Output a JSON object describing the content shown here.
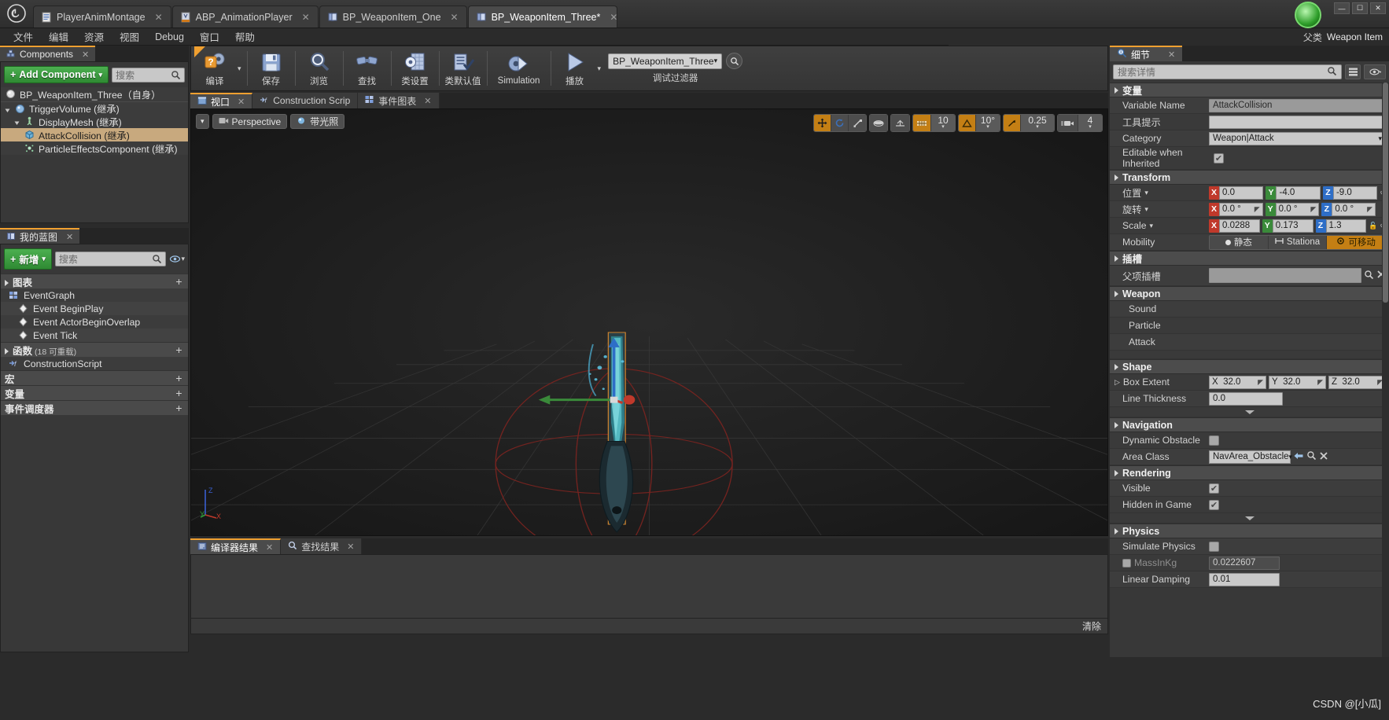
{
  "window": {
    "app_icon": "unreal-logo",
    "minimize": "—",
    "maximize": "☐",
    "close": "✕"
  },
  "tabs": [
    {
      "label": "PlayerAnimMontage",
      "icon": "anim-montage-icon",
      "active": false,
      "close": "✕"
    },
    {
      "label": "ABP_AnimationPlayer",
      "icon": "anim-blueprint-icon",
      "active": false,
      "close": "✕"
    },
    {
      "label": "BP_WeaponItem_One",
      "icon": "blueprint-icon",
      "active": false,
      "close": "✕"
    },
    {
      "label": "BP_WeaponItem_Three*",
      "icon": "blueprint-icon",
      "active": true,
      "close": "✕"
    }
  ],
  "menu": [
    "文件",
    "编辑",
    "资源",
    "视图",
    "Debug",
    "窗口",
    "帮助"
  ],
  "corner": {
    "label": "父类",
    "value": "Weapon Item"
  },
  "components_panel": {
    "tab_label": "Components",
    "tab_icon": "components-icon",
    "tab_close": "✕",
    "add_button": "Add Component",
    "add_button_plus": "+",
    "add_button_caret": "▾",
    "search_placeholder": "搜索",
    "search_icon": "search-icon",
    "root": {
      "label": "BP_WeaponItem_Three（自身）",
      "icon": "sphere-icon"
    },
    "tree": [
      {
        "label": "TriggerVolume (继承)",
        "icon": "sphere-blue-icon",
        "depth": 0,
        "expanded": true,
        "selected": false
      },
      {
        "label": "DisplayMesh (继承)",
        "icon": "skeletal-mesh-icon",
        "depth": 1,
        "expanded": true,
        "selected": false
      },
      {
        "label": "AttackCollision (继承)",
        "icon": "box-collision-icon",
        "depth": 2,
        "expanded": false,
        "selected": true
      },
      {
        "label": "ParticleEffectsComponent (继承)",
        "icon": "particle-icon",
        "depth": 2,
        "expanded": false,
        "selected": false
      }
    ]
  },
  "myblueprint_panel": {
    "tab_label": "我的蓝图",
    "tab_icon": "blueprint-icon",
    "tab_close": "✕",
    "add_button": "新增",
    "add_button_plus": "+",
    "add_button_caret": "▾",
    "search_placeholder": "搜索",
    "search_icon": "search-icon",
    "eye_icon": "eye-icon",
    "eye_caret": "▾",
    "sections": [
      {
        "title": "图表",
        "sub": "",
        "add": "+",
        "items": [
          {
            "label": "EventGraph",
            "icon": "event-graph-icon",
            "indent": false
          },
          {
            "label": "Event BeginPlay",
            "icon": "event-node-icon",
            "indent": true
          },
          {
            "label": "Event ActorBeginOverlap",
            "icon": "event-node-icon",
            "indent": true
          },
          {
            "label": "Event Tick",
            "icon": "event-node-icon",
            "indent": true
          }
        ]
      },
      {
        "title": "函数",
        "sub": "(18 可重载)",
        "add": "+",
        "items": [
          {
            "label": "ConstructionScript",
            "icon": "function-icon",
            "indent": false
          }
        ]
      },
      {
        "title": "宏",
        "sub": "",
        "add": "+",
        "items": []
      },
      {
        "title": "变量",
        "sub": "",
        "add": "+",
        "items": []
      },
      {
        "title": "事件调度器",
        "sub": "",
        "add": "+",
        "items": []
      }
    ]
  },
  "blueprint_toolbar": {
    "items": [
      {
        "label": "编译",
        "icon": "compile-icon",
        "has_caret": true
      },
      {
        "label": "保存",
        "icon": "save-icon",
        "has_caret": false
      },
      {
        "label": "浏览",
        "icon": "browse-icon",
        "has_caret": false
      },
      {
        "label": "查找",
        "icon": "find-icon",
        "has_caret": false
      },
      {
        "label": "类设置",
        "icon": "class-settings-icon",
        "has_caret": false
      },
      {
        "label": "类默认值",
        "icon": "class-defaults-icon",
        "has_caret": false
      },
      {
        "label": "Simulation",
        "icon": "simulation-icon",
        "has_caret": false
      },
      {
        "label": "播放",
        "icon": "play-icon",
        "has_caret": true
      }
    ],
    "debug_filter_value": "BP_WeaponItem_Three",
    "debug_filter_caret": "▾",
    "debug_filter_label": "调试过滤器",
    "debug_search_icon": "search-icon"
  },
  "viewport_tabs": [
    {
      "label": "视口",
      "icon": "viewport-icon",
      "active": true,
      "close": "✕"
    },
    {
      "label": "Construction Scrip",
      "icon": "construction-icon",
      "active": false,
      "close": ""
    },
    {
      "label": "事件图表",
      "icon": "event-graph-icon",
      "active": false,
      "close": "✕"
    }
  ],
  "viewport": {
    "menu_caret": "▾",
    "perspective_label": "Perspective",
    "perspective_icon": "camera-icon",
    "lit_label": "带光照",
    "lit_icon": "lit-icon",
    "transform_tools": [
      {
        "name": "select-tool",
        "glyph": "✥",
        "active": true
      },
      {
        "name": "rotate-tool",
        "glyph": "↺",
        "active": false
      },
      {
        "name": "scale-tool",
        "glyph": "⤢",
        "active": false
      }
    ],
    "coord_space": {
      "name": "world-space-toggle",
      "glyph": "◍",
      "active": false
    },
    "surface_snap": {
      "name": "surface-snap-toggle",
      "glyph": "⇪",
      "active": false
    },
    "grid_snap": {
      "name": "grid-snap-toggle",
      "glyph": "▦",
      "active": true,
      "value": "10"
    },
    "angle_snap": {
      "name": "angle-snap-toggle",
      "glyph": "◬",
      "active": true,
      "value": "10°"
    },
    "scale_snap": {
      "name": "scale-snap-toggle",
      "glyph": "↗",
      "active": true,
      "value": "0.25"
    },
    "camera_speed": {
      "name": "camera-speed",
      "glyph": "🎥",
      "value": "4"
    },
    "axis_labels": {
      "z": "Z",
      "y": "Y",
      "x": "X"
    }
  },
  "results_panel": {
    "tabs": [
      {
        "label": "编译器结果",
        "icon": "compiler-results-icon",
        "active": true,
        "close": "✕"
      },
      {
        "label": "查找结果",
        "icon": "find-results-icon",
        "active": false,
        "close": "✕"
      }
    ],
    "clear_label": "清除"
  },
  "details": {
    "tab_label": "细节",
    "tab_icon": "details-icon",
    "tab_close": "✕",
    "search_placeholder": "搜索详情",
    "search_icon": "search-icon",
    "layout_icon": "layout-icon",
    "view_icon": "eye-icon",
    "view_caret": "▾",
    "sections": [
      {
        "title": "变量",
        "rows": [
          {
            "kind": "text",
            "label": "Variable Name",
            "value": "AttackCollision",
            "style": "gray"
          },
          {
            "kind": "text",
            "label": "工具提示",
            "value": "",
            "style": "light"
          },
          {
            "kind": "text",
            "label": "Category",
            "value": "Weapon|Attack",
            "style": "combo"
          },
          {
            "kind": "check",
            "label": "Editable when Inherited",
            "checked": true
          }
        ]
      },
      {
        "title": "Transform",
        "rows": [
          {
            "kind": "vector",
            "label": "位置",
            "caret": "▾",
            "x": "0.0",
            "y": "-4.0",
            "z": "-9.0",
            "reset": true
          },
          {
            "kind": "vector",
            "label": "旋转",
            "caret": "▾",
            "x": "0.0 °",
            "y": "0.0 °",
            "z": "0.0 °",
            "reset": false
          },
          {
            "kind": "vector",
            "label": "Scale",
            "caret": "▾",
            "x": "0.0288",
            "y": "0.173",
            "z": "1.3",
            "lock": true,
            "reset": true
          },
          {
            "kind": "mobility",
            "label": "Mobility",
            "options": [
              {
                "label": "静态",
                "icon": "static-dot",
                "active": false
              },
              {
                "label": "Stationa",
                "icon": "stationary-icon",
                "active": false
              },
              {
                "label": "可移动",
                "icon": "movable-icon",
                "active": true
              }
            ]
          }
        ]
      },
      {
        "title": "插槽",
        "rows": [
          {
            "kind": "socket",
            "label": "父项插槽",
            "value": "",
            "search_icon": "search-icon",
            "clear_icon": "clear-icon"
          }
        ]
      },
      {
        "title": "Weapon",
        "rows": [
          {
            "kind": "plain",
            "label": "Sound",
            "value": ""
          },
          {
            "kind": "plain",
            "label": "Particle",
            "value": ""
          },
          {
            "kind": "plain",
            "label": "Attack",
            "value": ""
          },
          {
            "kind": "blank"
          }
        ]
      },
      {
        "title": "Shape",
        "rows": [
          {
            "kind": "vector",
            "label": "Box Extent",
            "expand": "▷",
            "x": "32.0",
            "y": "32.0",
            "z": "32.0",
            "reset": false
          },
          {
            "kind": "text",
            "label": "Line Thickness",
            "value": "0.0",
            "style": "light"
          },
          {
            "kind": "expander"
          }
        ]
      },
      {
        "title": "Navigation",
        "rows": [
          {
            "kind": "check",
            "label": "Dynamic Obstacle",
            "checked": false
          },
          {
            "kind": "combo_actions",
            "label": "Area Class",
            "value": "NavArea_Obstacle",
            "caret": "▾",
            "actions": [
              "back-icon",
              "search-icon",
              "clear-icon"
            ]
          }
        ]
      },
      {
        "title": "Rendering",
        "rows": [
          {
            "kind": "check",
            "label": "Visible",
            "checked": true
          },
          {
            "kind": "check",
            "label": "Hidden in Game",
            "checked": true
          },
          {
            "kind": "expander"
          }
        ]
      },
      {
        "title": "Physics",
        "rows": [
          {
            "kind": "check",
            "label": "Simulate Physics",
            "checked": false
          },
          {
            "kind": "text_cb",
            "label": "MassInKg",
            "checked": false,
            "value": "0.0222607",
            "style": "dark"
          },
          {
            "kind": "text",
            "label": "Linear Damping",
            "value": "0.01",
            "style": "light"
          }
        ]
      }
    ]
  },
  "watermark": "CSDN @[小瓜]",
  "colors": {
    "accent_orange": "#c47f14",
    "green_button": "#3f9e43",
    "selected_row": "#c8a97e",
    "axis_x": "#c0392b",
    "axis_y": "#3a8a3a",
    "axis_z": "#2e6ec7"
  }
}
